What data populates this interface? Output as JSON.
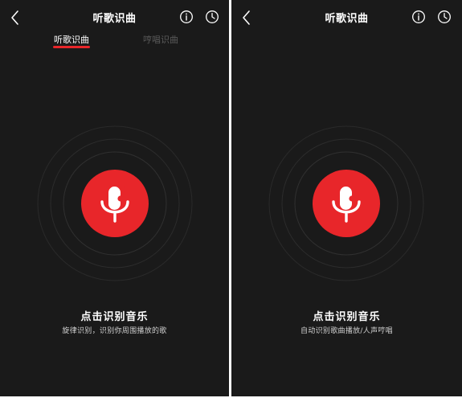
{
  "colors": {
    "background": "#1a1a1a",
    "accent": "#e8262a",
    "text_primary": "#ffffff",
    "text_secondary": "#cfcfcf",
    "tab_inactive": "#5a5a5a"
  },
  "screens": [
    {
      "header": {
        "title": "听歌识曲",
        "back_icon": "chevron-left-icon",
        "info_icon": "info-circle-icon",
        "history_icon": "clock-icon"
      },
      "tabs": [
        {
          "label": "听歌识曲",
          "active": true
        },
        {
          "label": "哼唱识曲",
          "active": false
        }
      ],
      "mic_button": {
        "icon": "microphone-music-note-icon"
      },
      "prompt": {
        "title": "点击识别音乐",
        "subtitle": "旋律识别，识别你周围播放的歌"
      }
    },
    {
      "header": {
        "title": "听歌识曲",
        "back_icon": "chevron-left-icon",
        "info_icon": "info-circle-icon",
        "history_icon": "clock-icon"
      },
      "mic_button": {
        "icon": "microphone-music-note-icon"
      },
      "prompt": {
        "title": "点击识别音乐",
        "subtitle": "自动识别歌曲播放/人声哼唱"
      }
    }
  ]
}
